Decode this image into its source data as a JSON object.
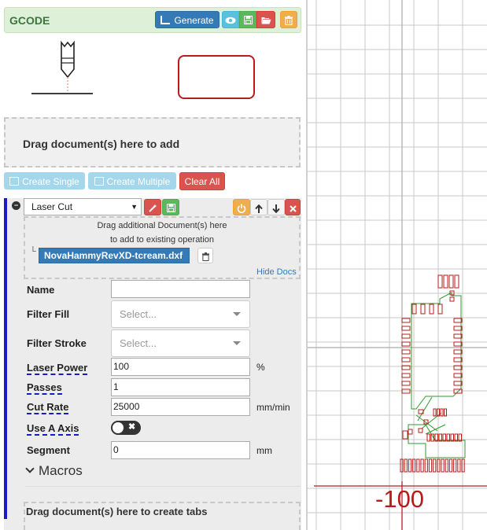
{
  "gcode": {
    "title": "GCODE",
    "generate_label": "Generate"
  },
  "documents": {
    "dropzone_text": "Drag document(s) here to add",
    "create_single_label": "Create Single",
    "create_multiple_label": "Create Multiple",
    "clear_all_label": "Clear All"
  },
  "operation": {
    "type_selected": "Laser Cut",
    "docs_drop_line1": "Drag additional Document(s) here",
    "docs_drop_line2": "to add to existing operation",
    "doc_tree_glyph": "└",
    "doc_name": "NovaHammyRevXD-tcream.dxf",
    "hide_docs_label": "Hide Docs",
    "fields": {
      "name_label": "Name",
      "name_value": "",
      "filter_fill_label": "Filter Fill",
      "filter_fill_placeholder": "Select...",
      "filter_stroke_label": "Filter Stroke",
      "filter_stroke_placeholder": "Select...",
      "laser_power_label": "Laser Power",
      "laser_power_value": "100",
      "laser_power_unit": "%",
      "passes_label": "Passes",
      "passes_value": "1",
      "cut_rate_label": "Cut Rate",
      "cut_rate_value": "25000",
      "cut_rate_unit": "mm/min",
      "use_a_axis_label": "Use A Axis",
      "use_a_axis_on": false,
      "toggle_off_glyph": "✖",
      "segment_label": "Segment",
      "segment_value": "0",
      "segment_unit": "mm"
    },
    "macros_label": "Macros",
    "tabs_dropzone_text": "Drag document(s) here to create tabs"
  },
  "viewer": {
    "axis_label": "-100",
    "colors": {
      "grid": "#c8c8c8",
      "axis": "#b71c1c",
      "pad": "#b71c1c",
      "trace": "#2e9a2e"
    }
  },
  "colors": {
    "primary": "#337ab7",
    "info": "#5bc0de",
    "success": "#5cb85c",
    "danger": "#d9534f",
    "warning": "#f0ad4e",
    "operation_stripe": "#1a1acc"
  }
}
